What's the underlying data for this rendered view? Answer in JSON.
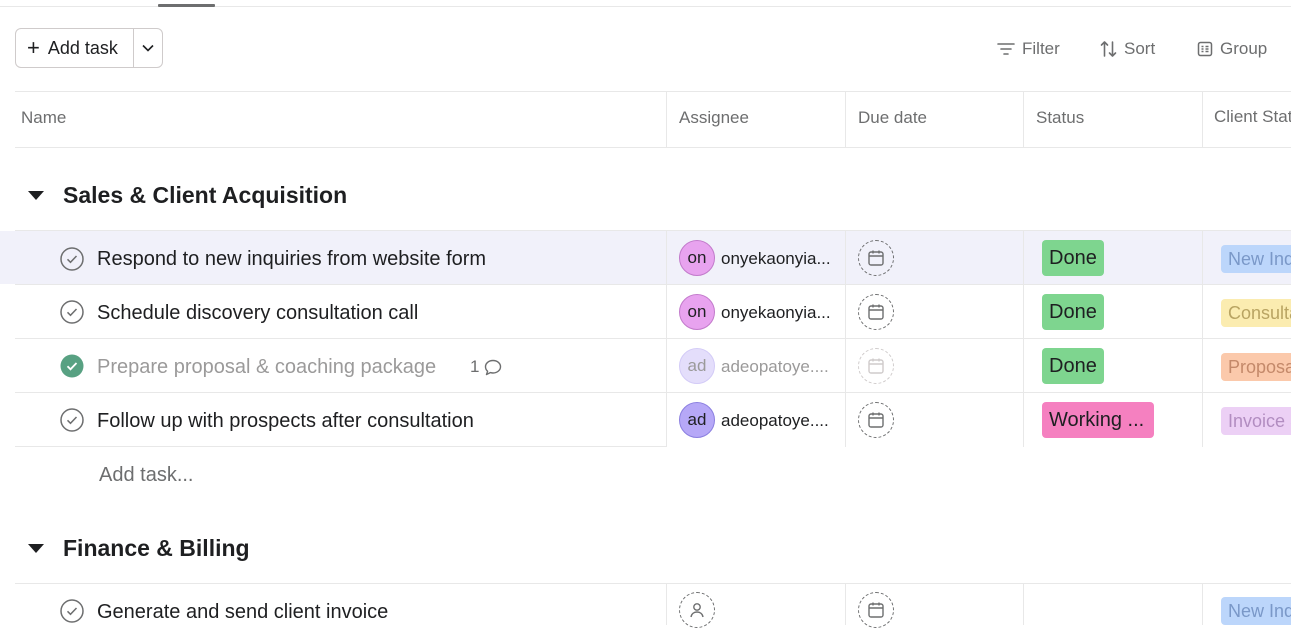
{
  "toolbar": {
    "add_task_label": "Add task",
    "filter_label": "Filter",
    "sort_label": "Sort",
    "group_label": "Group"
  },
  "columns": {
    "name": "Name",
    "assignee": "Assignee",
    "due_date": "Due date",
    "status": "Status",
    "client_status": "Client Stat"
  },
  "sections": [
    {
      "title": "Sales & Client Acquisition",
      "tasks": [
        {
          "name": "Respond to new inquiries from website form",
          "completed": false,
          "assignee_initials": "on",
          "assignee_name": "onyekaonyia...",
          "status": "Done",
          "client_status": "New Inq"
        },
        {
          "name": "Schedule discovery consultation call",
          "completed": false,
          "assignee_initials": "on",
          "assignee_name": "onyekaonyia...",
          "status": "Done",
          "client_status": "Consulta"
        },
        {
          "name": "Prepare proposal & coaching package",
          "completed": true,
          "comments": "1",
          "assignee_initials": "ad",
          "assignee_name": "adeopatoye....",
          "status": "Done",
          "client_status": "Proposa"
        },
        {
          "name": "Follow up with prospects after consultation",
          "completed": false,
          "assignee_initials": "ad",
          "assignee_name": "adeopatoye....",
          "status": "Working ...",
          "client_status": "Invoice S"
        }
      ],
      "add_task_label": "Add task..."
    },
    {
      "title": "Finance & Billing",
      "tasks": [
        {
          "name": "Generate and send client invoice",
          "completed": false,
          "client_status": "New Inq"
        }
      ]
    }
  ],
  "colors": {
    "status_done": "#7ed58f",
    "status_working": "#f580c0",
    "completed_check": "#58a182",
    "row_highlight": "#f1f1fa"
  },
  "icons": [
    "plus-icon",
    "chevron-down-icon",
    "filter-icon",
    "sort-icon",
    "group-icon",
    "check-circle-icon",
    "comment-icon",
    "calendar-icon",
    "person-icon",
    "caret-down-icon"
  ]
}
